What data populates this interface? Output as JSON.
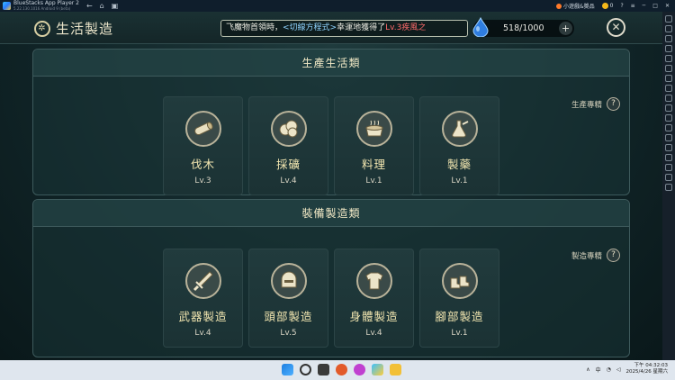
{
  "window": {
    "app_name": "BlueStacks App Player 2",
    "app_version": "5.22.130.1016  Android 9 (beta)",
    "promo_text": "小遊戲&獎品",
    "coin_count": "0",
    "controls": [
      "?",
      "≡",
      "─",
      "□",
      "✕"
    ]
  },
  "header": {
    "title": "生活製造",
    "marquee": {
      "prefix": "飞魔物首領時，",
      "skill": "<切線方程式>",
      "middle": "幸運地獲得了",
      "boss": "Lv.3疾風之"
    },
    "energy": {
      "value": "518/1000",
      "plus_label": "+"
    },
    "close_label": "✕"
  },
  "production": {
    "title": "生產生活類",
    "proficiency_label": "生產專精",
    "help_label": "?",
    "items": [
      {
        "name": "伐木",
        "level": "Lv.3",
        "icon": "log-icon"
      },
      {
        "name": "採礦",
        "level": "Lv.4",
        "icon": "ore-icon"
      },
      {
        "name": "料理",
        "level": "Lv.1",
        "icon": "cooking-pot-icon"
      },
      {
        "name": "製藥",
        "level": "Lv.1",
        "icon": "potion-flask-icon"
      }
    ]
  },
  "equipment": {
    "title": "裝備製造類",
    "proficiency_label": "製造專精",
    "help_label": "?",
    "items": [
      {
        "name": "武器製造",
        "level": "Lv.4",
        "icon": "sword-icon"
      },
      {
        "name": "頭部製造",
        "level": "Lv.5",
        "icon": "helmet-icon"
      },
      {
        "name": "身體製造",
        "level": "Lv.4",
        "icon": "armor-icon"
      },
      {
        "name": "腳部製造",
        "level": "Lv.1",
        "icon": "boots-icon"
      }
    ]
  },
  "taskbar": {
    "ime": "中",
    "time": "下午 04:32:03",
    "date": "2025/4/26 星期六"
  }
}
